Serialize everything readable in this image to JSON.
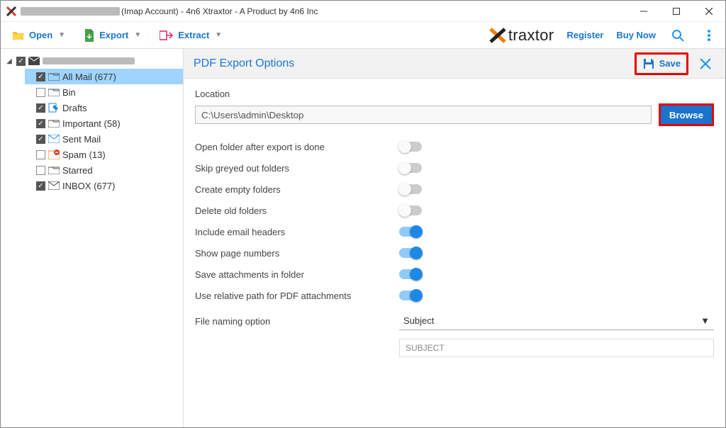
{
  "window": {
    "title_suffix": "(Imap Account) - 4n6 Xtraxtor - A Product by 4n6 Inc"
  },
  "toolbar": {
    "open": "Open",
    "export": "Export",
    "extract": "Extract",
    "brand": "traxtor",
    "register": "Register",
    "buy": "Buy Now"
  },
  "tree": {
    "items": [
      {
        "label": "All Mail",
        "count": "(677)",
        "checked": true,
        "selected": true,
        "icon": "folder"
      },
      {
        "label": "Bin",
        "count": "",
        "checked": false,
        "icon": "folder"
      },
      {
        "label": "Drafts",
        "count": "",
        "checked": true,
        "icon": "draft"
      },
      {
        "label": "Important",
        "count": "(58)",
        "checked": true,
        "icon": "folder"
      },
      {
        "label": "Sent Mail",
        "count": "",
        "checked": true,
        "icon": "sent"
      },
      {
        "label": "Spam",
        "count": "(13)",
        "checked": false,
        "icon": "spam"
      },
      {
        "label": "Starred",
        "count": "",
        "checked": false,
        "icon": "folder"
      },
      {
        "label": "INBOX",
        "count": "(677)",
        "checked": true,
        "icon": "inbox"
      }
    ]
  },
  "panel": {
    "title": "PDF Export Options",
    "save": "Save",
    "location_label": "Location",
    "location_value": "C:\\Users\\admin\\Desktop",
    "browse": "Browse",
    "opts": [
      {
        "label": "Open folder after export is done",
        "on": false
      },
      {
        "label": "Skip greyed out folders",
        "on": false
      },
      {
        "label": "Create empty folders",
        "on": false
      },
      {
        "label": "Delete old folders",
        "on": false
      },
      {
        "label": "Include email headers",
        "on": true
      },
      {
        "label": "Show page numbers",
        "on": true
      },
      {
        "label": "Save attachments in folder",
        "on": true
      },
      {
        "label": "Use relative path for PDF attachments",
        "on": true
      }
    ],
    "naming_label": "File naming option",
    "naming_value": "Subject",
    "naming_preview": "SUBJECT"
  }
}
